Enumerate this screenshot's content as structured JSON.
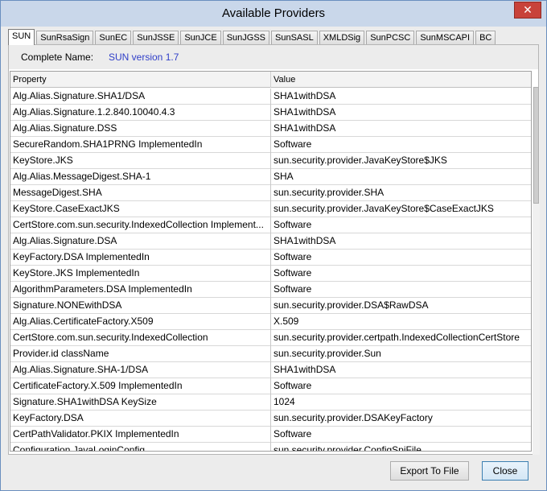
{
  "window": {
    "title": "Available Providers",
    "close_glyph": "✕"
  },
  "tabs": [
    {
      "label": "SUN",
      "active": true
    },
    {
      "label": "SunRsaSign",
      "active": false
    },
    {
      "label": "SunEC",
      "active": false
    },
    {
      "label": "SunJSSE",
      "active": false
    },
    {
      "label": "SunJCE",
      "active": false
    },
    {
      "label": "SunJGSS",
      "active": false
    },
    {
      "label": "SunSASL",
      "active": false
    },
    {
      "label": "XMLDSig",
      "active": false
    },
    {
      "label": "SunPCSC",
      "active": false
    },
    {
      "label": "SunMSCAPI",
      "active": false
    },
    {
      "label": "BC",
      "active": false
    }
  ],
  "provider": {
    "name_label": "Complete Name:",
    "name_value": "SUN version 1.7",
    "name_color": "#2f3ec8"
  },
  "table": {
    "columns": [
      "Property",
      "Value"
    ],
    "rows": [
      [
        "Alg.Alias.Signature.SHA1/DSA",
        "SHA1withDSA"
      ],
      [
        "Alg.Alias.Signature.1.2.840.10040.4.3",
        "SHA1withDSA"
      ],
      [
        "Alg.Alias.Signature.DSS",
        "SHA1withDSA"
      ],
      [
        "SecureRandom.SHA1PRNG ImplementedIn",
        "Software"
      ],
      [
        "KeyStore.JKS",
        "sun.security.provider.JavaKeyStore$JKS"
      ],
      [
        "Alg.Alias.MessageDigest.SHA-1",
        "SHA"
      ],
      [
        "MessageDigest.SHA",
        "sun.security.provider.SHA"
      ],
      [
        "KeyStore.CaseExactJKS",
        "sun.security.provider.JavaKeyStore$CaseExactJKS"
      ],
      [
        "CertStore.com.sun.security.IndexedCollection Implement...",
        "Software"
      ],
      [
        "Alg.Alias.Signature.DSA",
        "SHA1withDSA"
      ],
      [
        "KeyFactory.DSA ImplementedIn",
        "Software"
      ],
      [
        "KeyStore.JKS ImplementedIn",
        "Software"
      ],
      [
        "AlgorithmParameters.DSA ImplementedIn",
        "Software"
      ],
      [
        "Signature.NONEwithDSA",
        "sun.security.provider.DSA$RawDSA"
      ],
      [
        "Alg.Alias.CertificateFactory.X509",
        "X.509"
      ],
      [
        "CertStore.com.sun.security.IndexedCollection",
        "sun.security.provider.certpath.IndexedCollectionCertStore"
      ],
      [
        "Provider.id className",
        "sun.security.provider.Sun"
      ],
      [
        "Alg.Alias.Signature.SHA-1/DSA",
        "SHA1withDSA"
      ],
      [
        "CertificateFactory.X.509 ImplementedIn",
        "Software"
      ],
      [
        "Signature.SHA1withDSA KeySize",
        "1024"
      ],
      [
        "KeyFactory.DSA",
        "sun.security.provider.DSAKeyFactory"
      ],
      [
        "CertPathValidator.PKIX ImplementedIn",
        "Software"
      ],
      [
        "Configuration.JavaLoginConfig",
        "sun.security.provider.ConfigSpiFile"
      ]
    ]
  },
  "buttons": {
    "export": "Export To File",
    "close": "Close"
  },
  "colors": {
    "titlebar": "#c9d7ea",
    "close_button": "#c8423a",
    "link_text": "#2f3ec8"
  }
}
